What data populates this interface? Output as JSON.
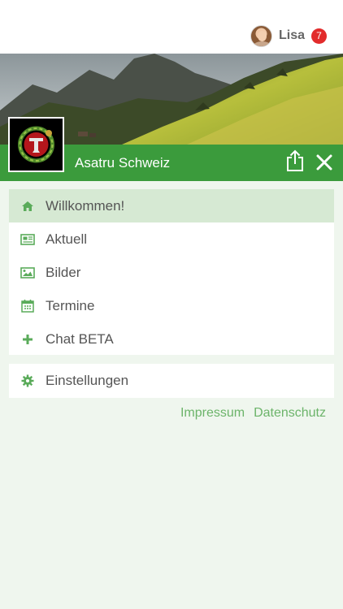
{
  "user": {
    "name": "Lisa",
    "notifications": "7"
  },
  "group": {
    "name": "Asatru Schweiz"
  },
  "menu": {
    "items": [
      {
        "label": "Willkommen!",
        "icon": "home-icon",
        "active": true
      },
      {
        "label": "Aktuell",
        "icon": "newspaper-icon",
        "active": false
      },
      {
        "label": "Bilder",
        "icon": "image-icon",
        "active": false
      },
      {
        "label": "Termine",
        "icon": "calendar-icon",
        "active": false
      },
      {
        "label": "Chat BETA",
        "icon": "plus-icon",
        "active": false
      }
    ],
    "settings_label": "Einstellungen"
  },
  "footer": {
    "impressum": "Impressum",
    "datenschutz": "Datenschutz"
  },
  "colors": {
    "accent": "#3b9b3c",
    "active_bg": "#d6e9d3",
    "icon": "#5aab5a",
    "link": "#6cb46a",
    "badge": "#e22b2b",
    "page_bg": "#eff6ee"
  }
}
